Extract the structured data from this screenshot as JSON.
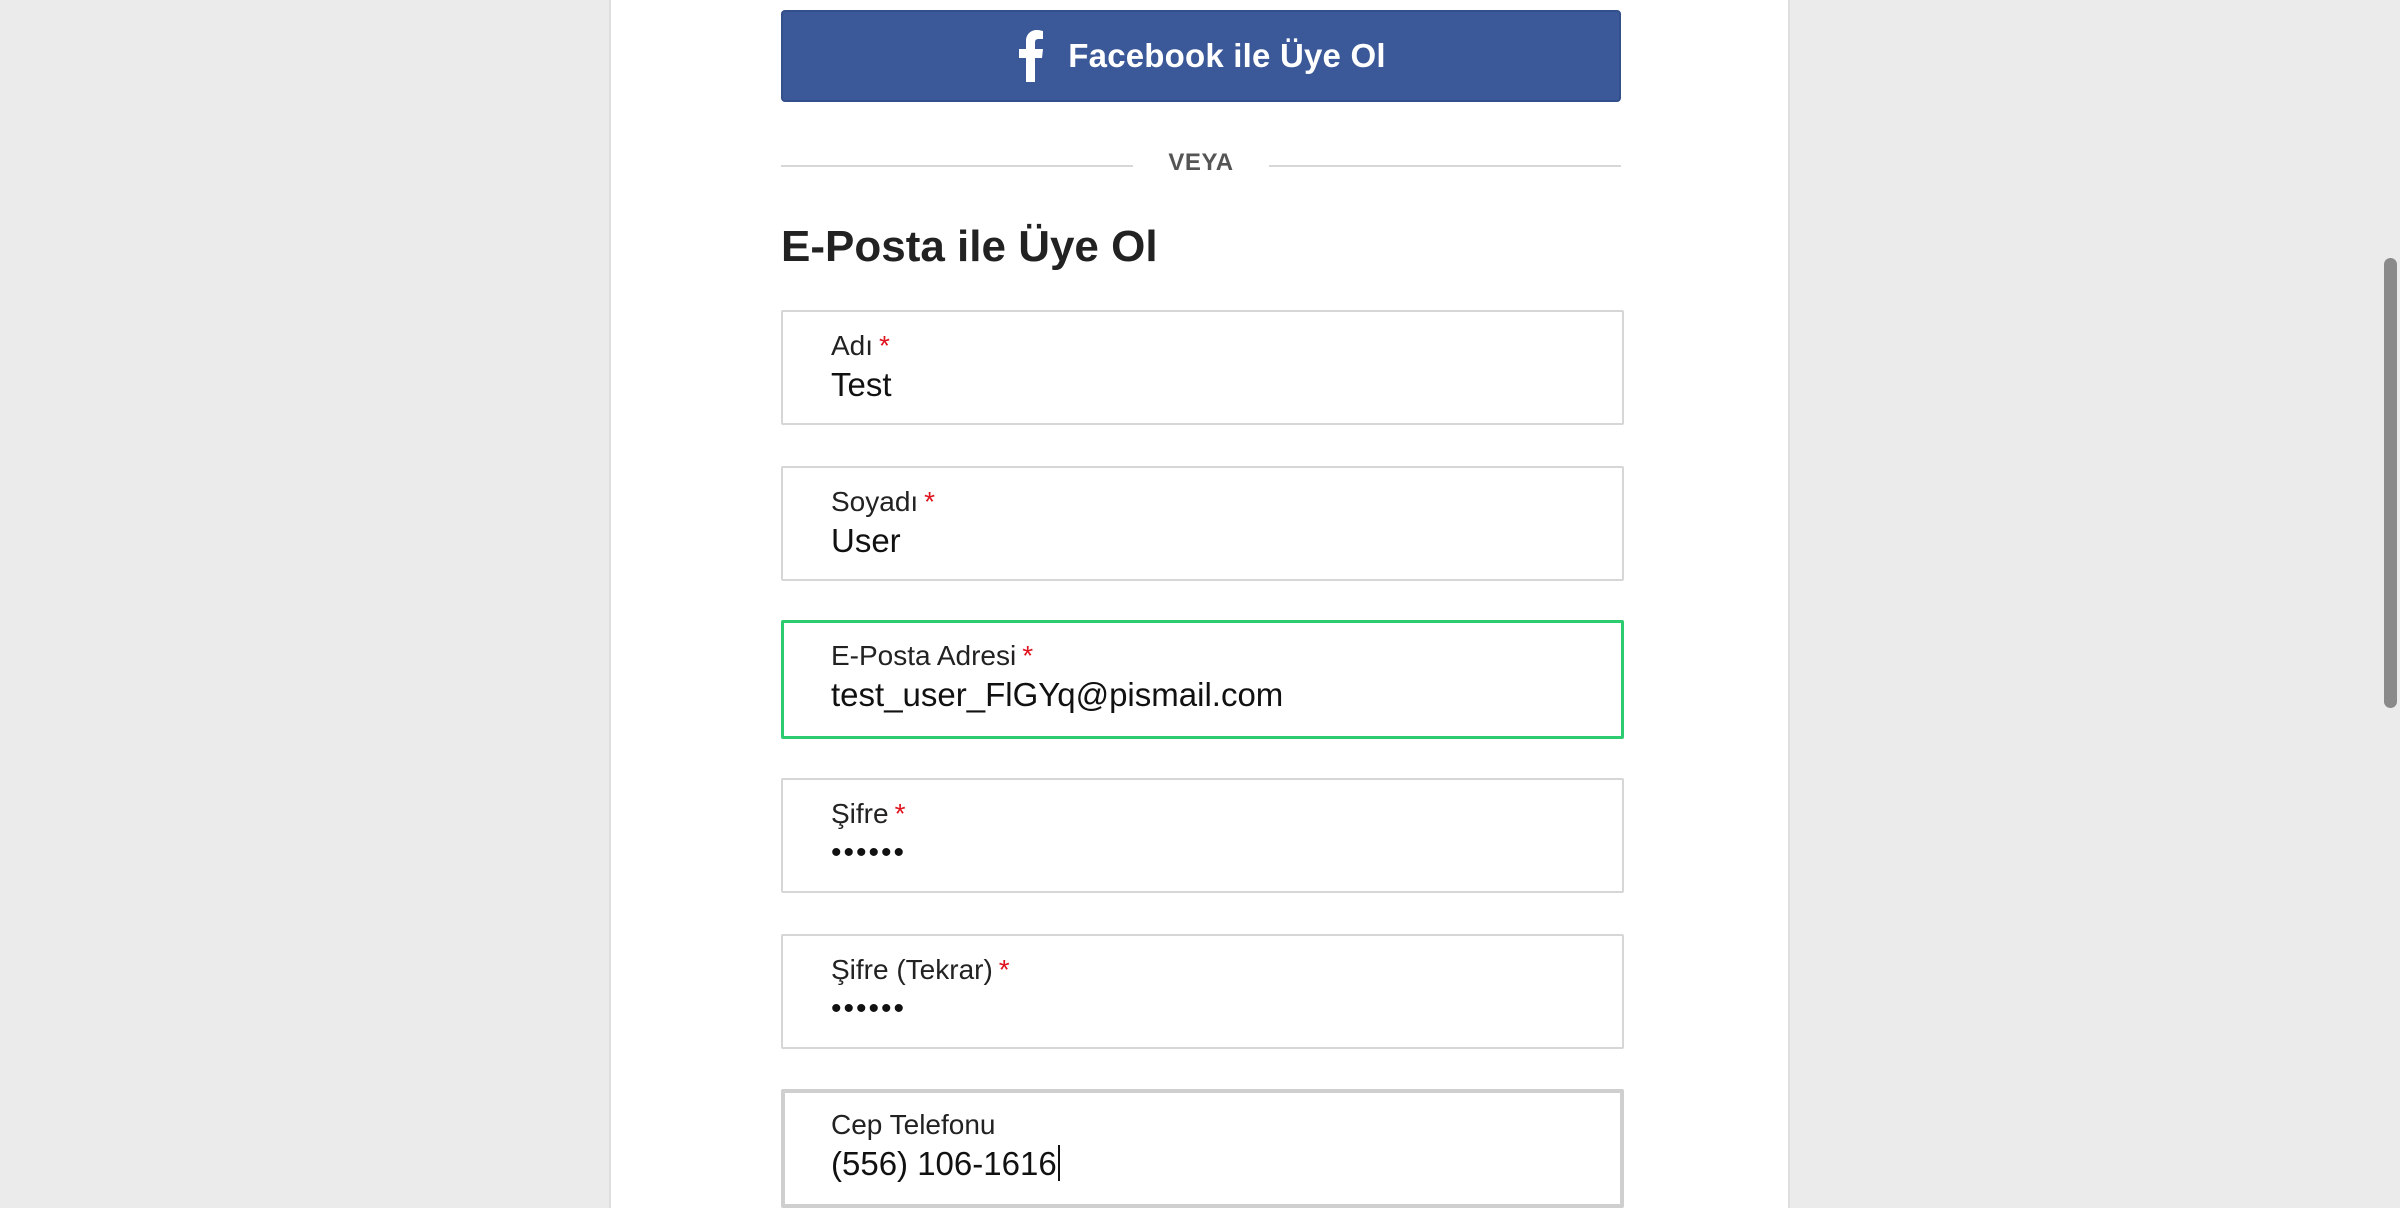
{
  "facebook_button": {
    "label": "Facebook ile Üye Ol",
    "icon": "facebook-f-icon",
    "color": "#3b5998"
  },
  "divider": {
    "text": "VEYA"
  },
  "form": {
    "title": "E-Posta ile Üye Ol",
    "required_marker": "*",
    "accent_focus_color": "#2ecc71",
    "fields": [
      {
        "label": "Adı",
        "value": "Test",
        "required": true
      },
      {
        "label": "Soyadı",
        "value": "User",
        "required": true
      },
      {
        "label": "E-Posta Adresi",
        "value": "test_user_FlGYq@pismail.com",
        "required": true
      },
      {
        "label": "Şifre",
        "value": "••••••",
        "required": true
      },
      {
        "label": "Şifre (Tekrar)",
        "value": "••••••",
        "required": true
      },
      {
        "label": "Cep Telefonu",
        "value": "(556) 106-1616",
        "required": false
      }
    ]
  }
}
